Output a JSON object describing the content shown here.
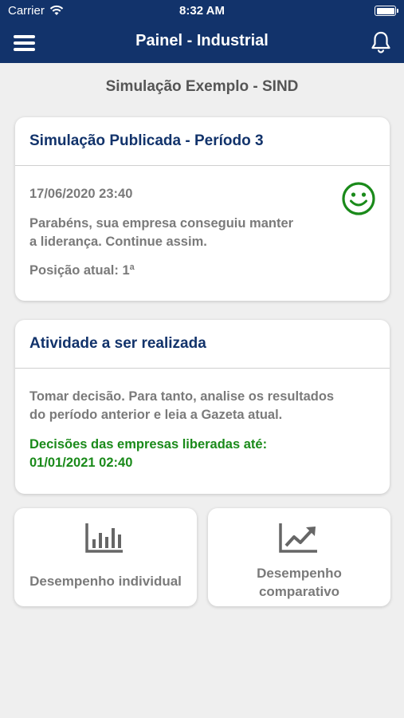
{
  "status_bar": {
    "carrier": "Carrier",
    "time": "8:32 AM"
  },
  "navbar": {
    "title": "Painel - Industrial",
    "left_icon": "menu-icon",
    "right_icon": "bell-icon"
  },
  "page": {
    "title": "Simulação Exemplo - SIND"
  },
  "published_card": {
    "header": "Simulação Publicada - Período 3",
    "datetime": "17/06/2020 23:40",
    "message_line1": "Parabéns, sua empresa conseguiu manter",
    "message_line2": "a liderança. Continue assim.",
    "position": "Posição atual: 1ª",
    "status_icon": "smiley-icon",
    "status_color": "#1a8a1a"
  },
  "activity_card": {
    "header": "Atividade a ser realizada",
    "instruction_line1": "Tomar decisão. Para tanto, analise os resultados",
    "instruction_line2": "do período anterior e leia a Gazeta atual.",
    "deadline_line1": "Decisões das empresas liberadas até:",
    "deadline_line2": "01/01/2021 02:40",
    "deadline_color": "#1a8a1a"
  },
  "tiles": [
    {
      "label": "Desempenho individual",
      "icon": "bar-chart-icon"
    },
    {
      "label_line1": "Desempenho",
      "label_line2": "comparativo",
      "icon": "trend-chart-icon"
    }
  ],
  "colors": {
    "navbar": "#12336b",
    "background": "#efefef",
    "accent_text": "#12336b",
    "muted_text": "#7a7a7a"
  }
}
